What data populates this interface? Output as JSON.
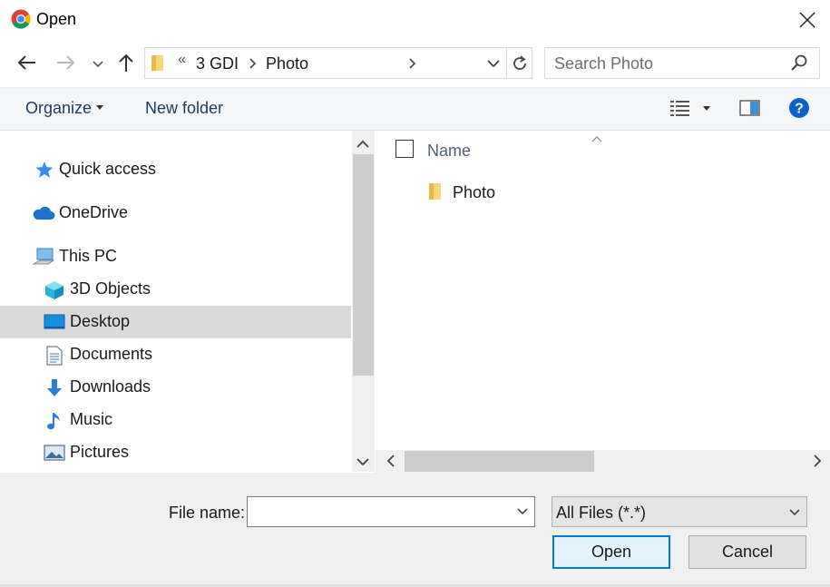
{
  "window": {
    "title": "Open",
    "app_icon": "chrome-icon",
    "close_glyph": "✕"
  },
  "navigation": {
    "back_icon": "arrow-left-icon",
    "forward_icon": "arrow-right-icon",
    "recent_icon": "chevron-down-icon",
    "up_icon": "arrow-up-icon"
  },
  "address": {
    "overflow_glyph": "«",
    "segments": [
      "3 GDI",
      "Photo"
    ],
    "refresh_icon": "refresh-icon"
  },
  "search": {
    "placeholder": "Search Photo",
    "icon": "search-icon"
  },
  "toolbar": {
    "organize_label": "Organize",
    "new_folder_label": "New folder",
    "view_icon": "details-view-icon",
    "preview_icon": "preview-pane-icon",
    "help_icon": "help-icon",
    "help_glyph": "?"
  },
  "sidebar": {
    "items": [
      {
        "label": "Quick access",
        "icon": "star-icon"
      },
      {
        "label": "OneDrive",
        "icon": "cloud-icon"
      },
      {
        "label": "This PC",
        "icon": "computer-icon"
      },
      {
        "label": "3D Objects",
        "icon": "cube-icon"
      },
      {
        "label": "Desktop",
        "icon": "desktop-icon",
        "selected": true
      },
      {
        "label": "Documents",
        "icon": "document-icon"
      },
      {
        "label": "Downloads",
        "icon": "download-icon"
      },
      {
        "label": "Music",
        "icon": "music-icon"
      },
      {
        "label": "Pictures",
        "icon": "picture-icon"
      }
    ]
  },
  "file_list": {
    "column_header": "Name",
    "rows": [
      {
        "name": "Photo",
        "icon": "folder-icon"
      }
    ]
  },
  "footer": {
    "file_name_label": "File name:",
    "file_name_value": "",
    "file_type_value": "All Files (*.*)",
    "open_label": "Open",
    "cancel_label": "Cancel"
  },
  "colors": {
    "accent": "#0078d7",
    "selected_bg": "#dadada",
    "header_text": "#4c607a"
  }
}
